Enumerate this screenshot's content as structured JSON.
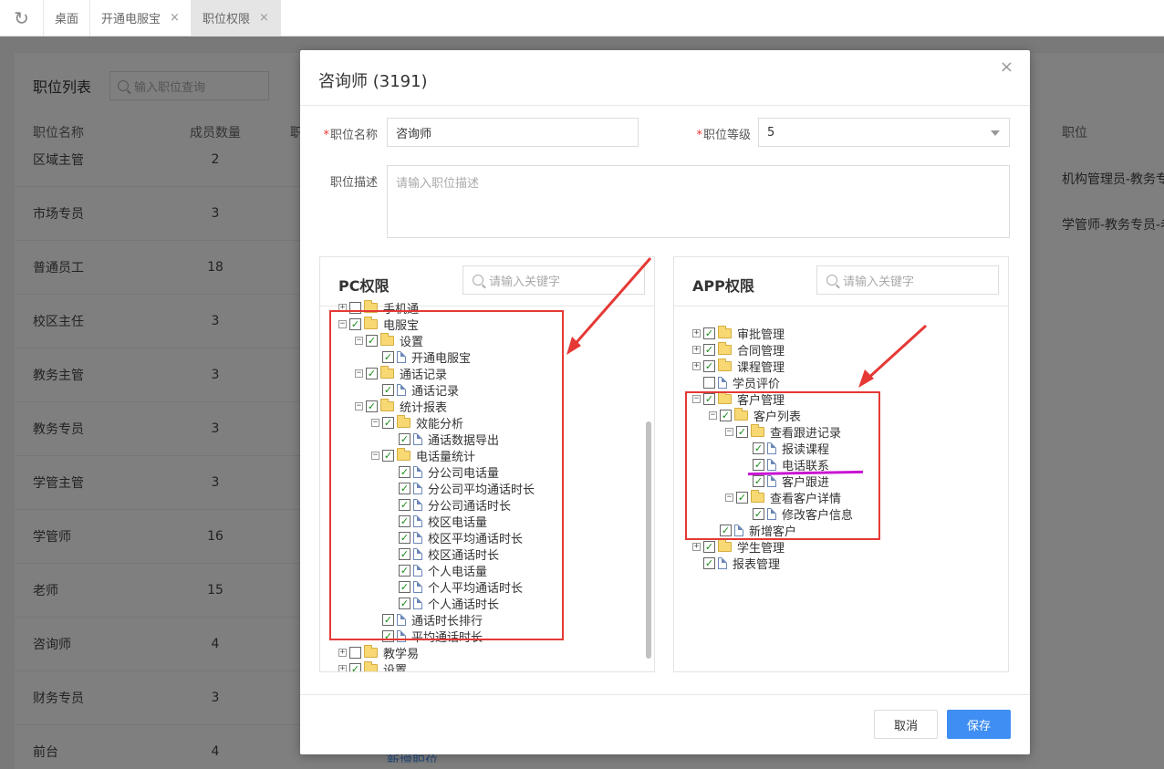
{
  "tabs": [
    {
      "label": "桌面",
      "closable": false,
      "active": false
    },
    {
      "label": "开通电服宝",
      "closable": true,
      "active": false
    },
    {
      "label": "职位权限",
      "closable": true,
      "active": true
    }
  ],
  "background": {
    "title": "职位列表",
    "search_placeholder": "输入职位查询",
    "col_name": "职位名称",
    "col_count": "成员数量",
    "col_truncated": "职",
    "col_right": "职位",
    "rows": [
      {
        "name": "区域主管",
        "count": "2"
      },
      {
        "name": "市场专员",
        "count": "3"
      },
      {
        "name": "普通员工",
        "count": "18"
      },
      {
        "name": "校区主任",
        "count": "3"
      },
      {
        "name": "教务主管",
        "count": "3"
      },
      {
        "name": "教务专员",
        "count": "3"
      },
      {
        "name": "学管主管",
        "count": "3"
      },
      {
        "name": "学管师",
        "count": "16"
      },
      {
        "name": "老师",
        "count": "15"
      },
      {
        "name": "咨询师",
        "count": "4"
      },
      {
        "name": "财务专员",
        "count": "3"
      },
      {
        "name": "前台",
        "count": "4"
      }
    ],
    "right_rows": [
      "机构管理员-教务专",
      "学管师-教务专员-老"
    ],
    "bottom_link": "新增职位"
  },
  "modal": {
    "title": "咨询师 (3191)",
    "close": "×",
    "name_label": "职位名称",
    "name_value": "咨询师",
    "level_label": "职位等级",
    "level_value": "5",
    "desc_label": "职位描述",
    "desc_placeholder": "请输入职位描述",
    "cancel": "取消",
    "save": "保存"
  },
  "pc": {
    "title": "PC权限",
    "search_placeholder": "请输入关键字",
    "partial_top": "手机通",
    "nodes": [
      {
        "label": "电服宝",
        "level": 0,
        "type": "folder",
        "expander": "minus",
        "checked": true
      },
      {
        "label": "设置",
        "level": 1,
        "type": "folder",
        "expander": "minus",
        "checked": true
      },
      {
        "label": "开通电服宝",
        "level": 2,
        "type": "file",
        "expander": "none",
        "checked": true
      },
      {
        "label": "通话记录",
        "level": 1,
        "type": "folder",
        "expander": "minus",
        "checked": true
      },
      {
        "label": "通话记录",
        "level": 2,
        "type": "file",
        "expander": "none",
        "checked": true
      },
      {
        "label": "统计报表",
        "level": 1,
        "type": "folder",
        "expander": "minus",
        "checked": true
      },
      {
        "label": "效能分析",
        "level": 2,
        "type": "folder",
        "expander": "minus",
        "checked": true
      },
      {
        "label": "通话数据导出",
        "level": 3,
        "type": "file",
        "expander": "none",
        "checked": true
      },
      {
        "label": "电话量统计",
        "level": 2,
        "type": "folder",
        "expander": "minus",
        "checked": true
      },
      {
        "label": "分公司电话量",
        "level": 3,
        "type": "file",
        "expander": "none",
        "checked": true
      },
      {
        "label": "分公司平均通话时长",
        "level": 3,
        "type": "file",
        "expander": "none",
        "checked": true
      },
      {
        "label": "分公司通话时长",
        "level": 3,
        "type": "file",
        "expander": "none",
        "checked": true
      },
      {
        "label": "校区电话量",
        "level": 3,
        "type": "file",
        "expander": "none",
        "checked": true
      },
      {
        "label": "校区平均通话时长",
        "level": 3,
        "type": "file",
        "expander": "none",
        "checked": true
      },
      {
        "label": "校区通话时长",
        "level": 3,
        "type": "file",
        "expander": "none",
        "checked": true
      },
      {
        "label": "个人电话量",
        "level": 3,
        "type": "file",
        "expander": "none",
        "checked": true
      },
      {
        "label": "个人平均通话时长",
        "level": 3,
        "type": "file",
        "expander": "none",
        "checked": true
      },
      {
        "label": "个人通话时长",
        "level": 3,
        "type": "file",
        "expander": "none",
        "checked": true
      },
      {
        "label": "通话时长排行",
        "level": 2,
        "type": "file",
        "expander": "none",
        "checked": true
      },
      {
        "label": "平均通话时长",
        "level": 2,
        "type": "file",
        "expander": "none",
        "checked": true
      },
      {
        "label": "教学易",
        "level": 0,
        "type": "folder",
        "expander": "plus",
        "checked": false
      },
      {
        "label": "设置",
        "level": 0,
        "type": "folder",
        "expander": "plus",
        "checked": true
      }
    ]
  },
  "app": {
    "title": "APP权限",
    "search_placeholder": "请输入关键字",
    "nodes": [
      {
        "label": "审批管理",
        "level": 0,
        "type": "folder",
        "expander": "plus",
        "checked": true
      },
      {
        "label": "合同管理",
        "level": 0,
        "type": "folder",
        "expander": "plus",
        "checked": true
      },
      {
        "label": "课程管理",
        "level": 0,
        "type": "folder",
        "expander": "plus",
        "checked": true
      },
      {
        "label": "学员评价",
        "level": 0,
        "type": "file",
        "expander": "none",
        "checked": false
      },
      {
        "label": "客户管理",
        "level": 0,
        "type": "folder",
        "expander": "minus",
        "checked": true
      },
      {
        "label": "客户列表",
        "level": 1,
        "type": "folder",
        "expander": "minus",
        "checked": true
      },
      {
        "label": "查看跟进记录",
        "level": 2,
        "type": "folder",
        "expander": "minus",
        "checked": true
      },
      {
        "label": "报读课程",
        "level": 3,
        "type": "file",
        "expander": "none",
        "checked": true
      },
      {
        "label": "电话联系",
        "level": 3,
        "type": "file",
        "expander": "none",
        "checked": true
      },
      {
        "label": "客户跟进",
        "level": 3,
        "type": "file",
        "expander": "none",
        "checked": true
      },
      {
        "label": "查看客户详情",
        "level": 2,
        "type": "folder",
        "expander": "minus",
        "checked": true
      },
      {
        "label": "修改客户信息",
        "level": 3,
        "type": "file",
        "expander": "none",
        "checked": true
      },
      {
        "label": "新增客户",
        "level": 1,
        "type": "file",
        "expander": "none",
        "checked": true
      },
      {
        "label": "学生管理",
        "level": 0,
        "type": "folder",
        "expander": "plus",
        "checked": true
      },
      {
        "label": "报表管理",
        "level": 0,
        "type": "file",
        "expander": "none",
        "checked": true
      }
    ]
  },
  "colors": {
    "annotation_red": "#e53935",
    "annotation_purple": "#c815d2",
    "primary": "#3f8ef3",
    "check": "#1a8a1a"
  }
}
